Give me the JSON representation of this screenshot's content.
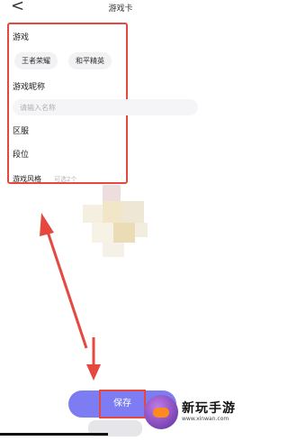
{
  "header": {
    "back_glyph": "<",
    "title": "游戏卡"
  },
  "form": {
    "game_label": "游戏",
    "games": [
      "王者荣耀",
      "和平精英"
    ],
    "nickname_label": "游戏昵称",
    "nickname_placeholder": "请输入名称",
    "region_label": "区服",
    "rank_label": "段位",
    "style_label": "游戏风格",
    "style_hint": "可选2个"
  },
  "footer": {
    "save_label": "保存"
  },
  "watermark": {
    "brand_text": "新玩手游",
    "url_text": "www.xinwan.com"
  },
  "colors": {
    "accent": "#7d7cf2",
    "annotation_red": "#e5483f"
  }
}
